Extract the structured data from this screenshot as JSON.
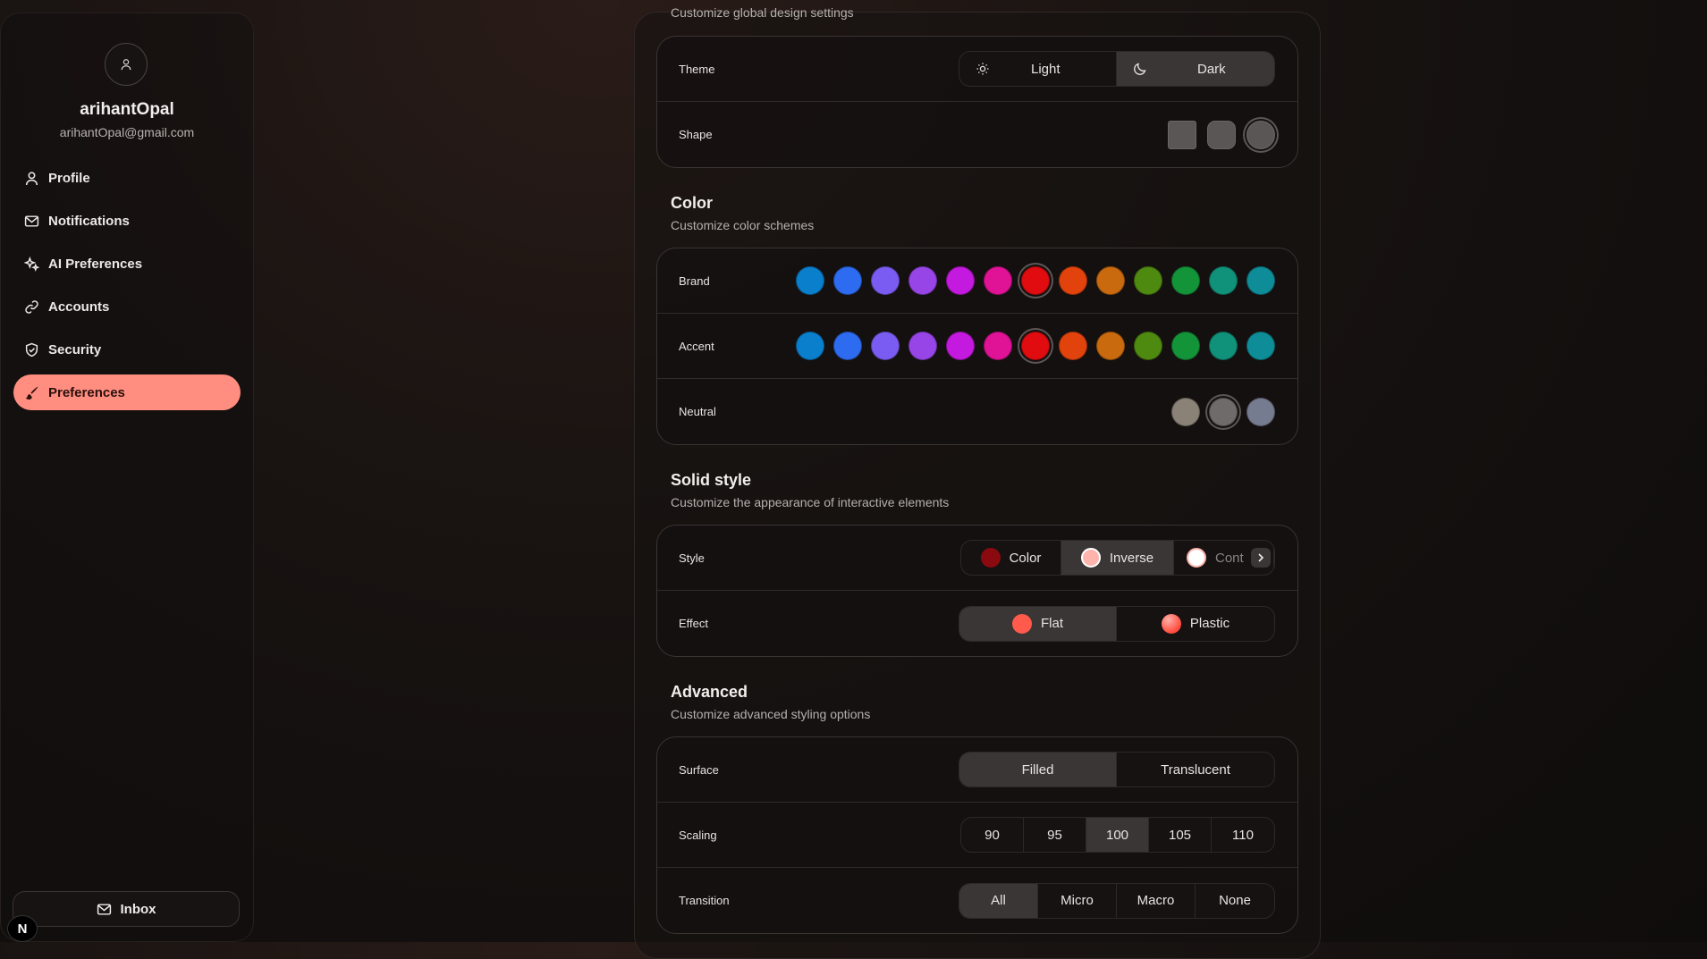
{
  "user": {
    "name": "arihantOpal",
    "email": "arihantOpal@gmail.com"
  },
  "nav": [
    {
      "label": "Profile",
      "icon": "person-icon"
    },
    {
      "label": "Notifications",
      "icon": "envelope-icon"
    },
    {
      "label": "AI Preferences",
      "icon": "sparkle-icon"
    },
    {
      "label": "Accounts",
      "icon": "link-icon"
    },
    {
      "label": "Security",
      "icon": "shield-icon"
    },
    {
      "label": "Preferences",
      "icon": "brush-icon",
      "active": true
    }
  ],
  "inbox": {
    "label": "Inbox"
  },
  "badge": {
    "letter": "N"
  },
  "design": {
    "subtitle": "Customize global design settings",
    "theme": {
      "label": "Theme",
      "options": [
        "Light",
        "Dark"
      ],
      "selected": "Dark"
    },
    "shape": {
      "label": "Shape",
      "selected": "round"
    }
  },
  "color": {
    "title": "Color",
    "subtitle": "Customize color schemes",
    "brand": {
      "label": "Brand",
      "selected": "#e00c10"
    },
    "accent": {
      "label": "Accent",
      "selected": "#e00c10"
    },
    "neutral": {
      "label": "Neutral",
      "selected": "#6e6b6a"
    },
    "palette": [
      "#0a7fcc",
      "#2d6bf0",
      "#7b5cf2",
      "#9845e8",
      "#c419df",
      "#e01296",
      "#e00c10",
      "#e2430d",
      "#c96a0e",
      "#4f8a10",
      "#149438",
      "#10917a",
      "#0e8d98"
    ],
    "neutral_palette": [
      "#8a8276",
      "#6e6b6a",
      "#767c90"
    ]
  },
  "solid": {
    "title": "Solid style",
    "subtitle": "Customize the appearance of interactive elements",
    "style": {
      "label": "Style",
      "options": [
        "Color",
        "Inverse",
        "Cont"
      ],
      "selected": "Inverse",
      "dots": [
        "#8a0a10",
        "#ffb3ad",
        "#ffffff"
      ]
    },
    "effect": {
      "label": "Effect",
      "options": [
        "Flat",
        "Plastic"
      ],
      "selected": "Flat",
      "dots": [
        "#ff5a4c",
        "#ff6a5e"
      ]
    }
  },
  "advanced": {
    "title": "Advanced",
    "subtitle": "Customize advanced styling options",
    "surface": {
      "label": "Surface",
      "options": [
        "Filled",
        "Translucent"
      ],
      "selected": "Filled"
    },
    "scaling": {
      "label": "Scaling",
      "options": [
        "90",
        "95",
        "100",
        "105",
        "110"
      ],
      "selected": "100"
    },
    "transition": {
      "label": "Transition",
      "options": [
        "All",
        "Micro",
        "Macro",
        "None"
      ],
      "selected": "All"
    }
  },
  "colors": {
    "accent": "#ff8e80",
    "background": "#120f0e"
  }
}
